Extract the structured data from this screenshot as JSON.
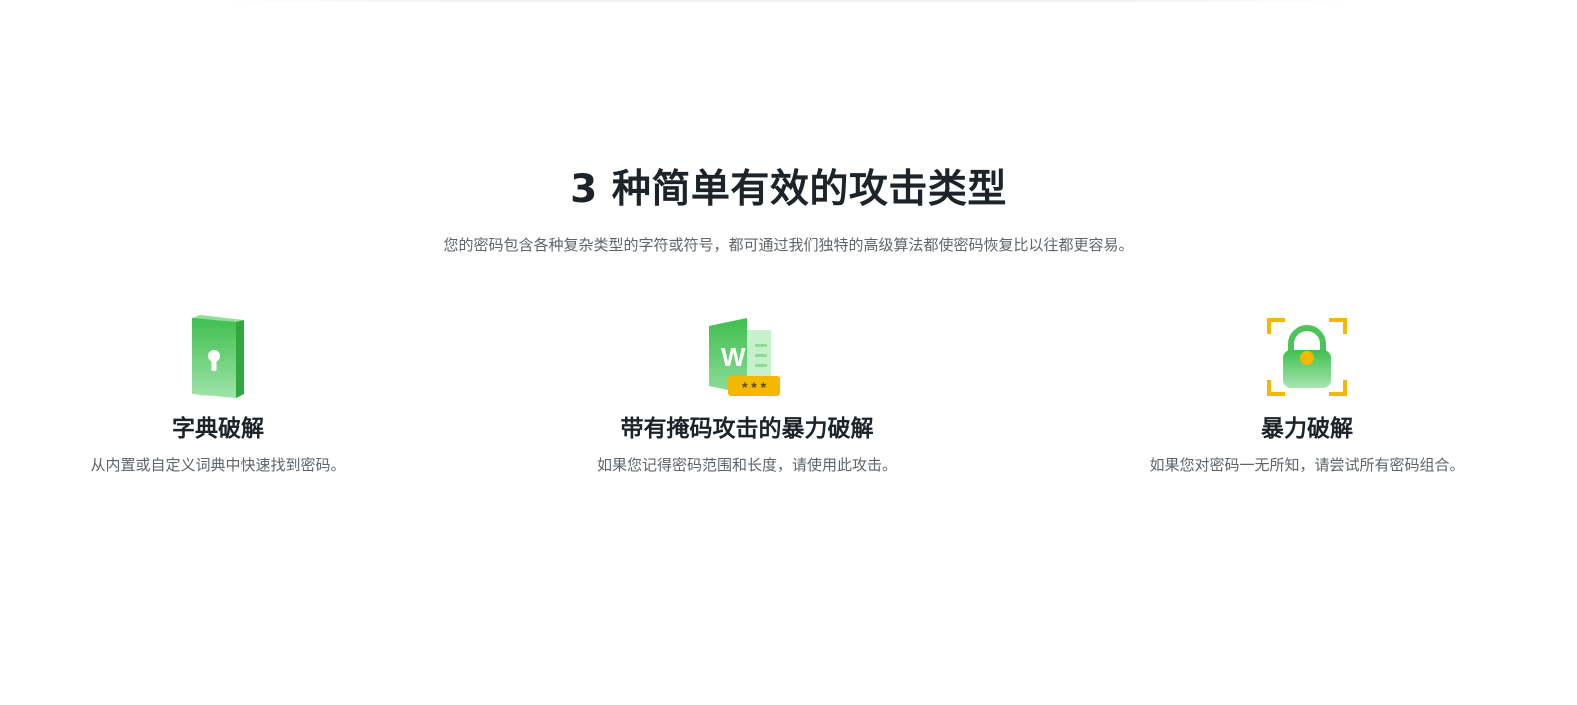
{
  "section": {
    "title": "3 种简单有效的攻击类型",
    "subtitle": "您的密码包含各种复杂类型的字符或符号，都可通过我们独特的高级算法都使密码恢复比以往都更容易。"
  },
  "features": [
    {
      "icon": "dictionary-book-lock-icon",
      "title": "字典破解",
      "description": "从内置或自定义词典中快速找到密码。"
    },
    {
      "icon": "word-document-password-icon",
      "title": "带有掩码攻击的暴力破解",
      "description": "如果您记得密码范围和长度，请使用此攻击。"
    },
    {
      "icon": "padlock-scan-icon",
      "title": "暴力破解",
      "description": "如果您对密码一无所知，请尝试所有密码组合。"
    }
  ],
  "icon_labels": {
    "word_letter": "W",
    "mask_stars": "* * *"
  },
  "colors": {
    "green_dark": "#39b54a",
    "green_light": "#a8e6b0",
    "yellow": "#f5b800",
    "title": "#1d2328",
    "text_muted": "#5f6468"
  }
}
